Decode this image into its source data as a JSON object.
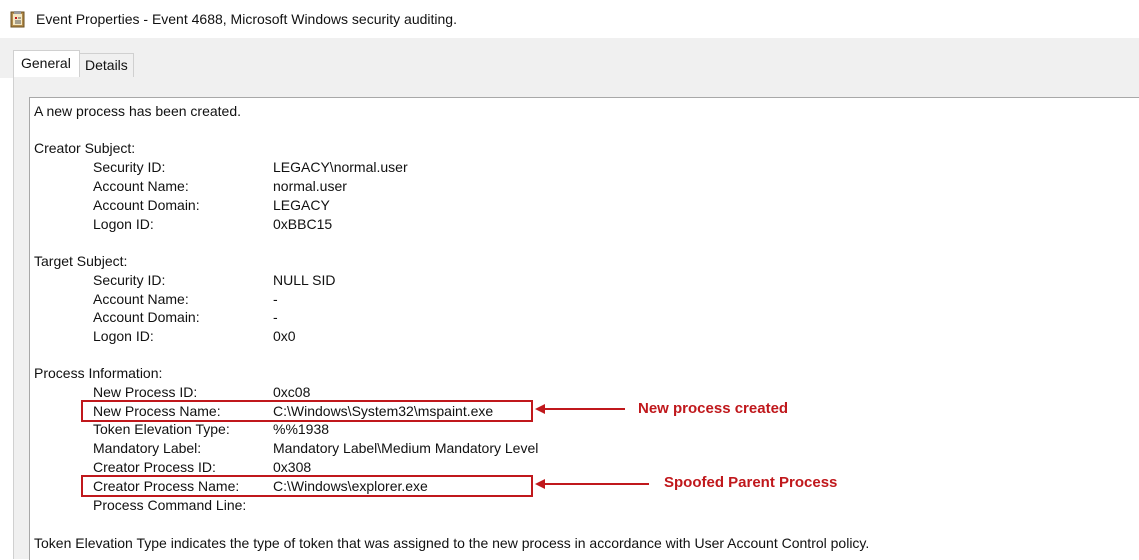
{
  "window": {
    "title": "Event Properties - Event 4688, Microsoft Windows security auditing."
  },
  "tabs": [
    {
      "label": "General",
      "active": true
    },
    {
      "label": "Details",
      "active": false
    }
  ],
  "event": {
    "intro": "A new process has been created.",
    "sections": [
      {
        "header": "Creator Subject:",
        "fields": [
          {
            "label": "Security ID:",
            "value": "LEGACY\\normal.user"
          },
          {
            "label": "Account Name:",
            "value": "normal.user"
          },
          {
            "label": "Account Domain:",
            "value": "LEGACY"
          },
          {
            "label": "Logon ID:",
            "value": "0xBBC15"
          }
        ]
      },
      {
        "header": "Target Subject:",
        "fields": [
          {
            "label": "Security ID:",
            "value": "NULL SID"
          },
          {
            "label": "Account Name:",
            "value": "-"
          },
          {
            "label": "Account Domain:",
            "value": "-"
          },
          {
            "label": "Logon ID:",
            "value": "0x0"
          }
        ]
      },
      {
        "header": "Process Information:",
        "fields": [
          {
            "label": "New Process ID:",
            "value": "0xc08"
          },
          {
            "label": "New Process Name:",
            "value": "C:\\Windows\\System32\\mspaint.exe"
          },
          {
            "label": "Token Elevation Type:",
            "value": "%%1938"
          },
          {
            "label": "Mandatory Label:",
            "value": "Mandatory Label\\Medium Mandatory Level"
          },
          {
            "label": "Creator Process ID:",
            "value": "0x308"
          },
          {
            "label": "Creator Process Name:",
            "value": "C:\\Windows\\explorer.exe"
          },
          {
            "label": "Process Command Line:",
            "value": ""
          }
        ]
      }
    ],
    "footer": "Token Elevation Type indicates the type of token that was assigned to the new process in accordance with User Account Control policy."
  },
  "annotations": {
    "new_process": "New process created",
    "spoofed_parent": "Spoofed Parent Process"
  },
  "colors": {
    "annotation": "#c0181c"
  }
}
